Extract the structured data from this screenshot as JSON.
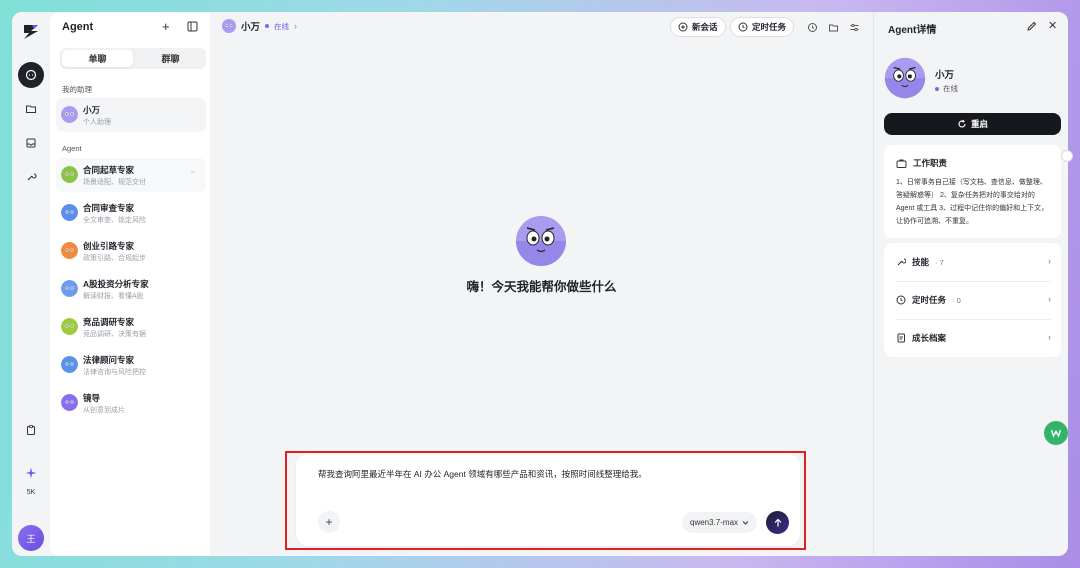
{
  "sidebar": {
    "title": "Agent",
    "tabs": [
      {
        "label": "单聊",
        "active": true
      },
      {
        "label": "群聊",
        "active": false
      }
    ],
    "assistant_section": "我的助理",
    "assistant": {
      "name": "小万",
      "desc": "个人助理"
    },
    "agent_section": "Agent",
    "agents": [
      {
        "name": "合同起草专家",
        "desc": "场景适配、规范交付"
      },
      {
        "name": "合同审查专家",
        "desc": "全文审查、锁定风险"
      },
      {
        "name": "创业引路专家",
        "desc": "政策引路、合规起步"
      },
      {
        "name": "A股投资分析专家",
        "desc": "解读财报、看懂A股"
      },
      {
        "name": "竞品调研专家",
        "desc": "竞品调研、决策有据"
      },
      {
        "name": "法律顾问专家",
        "desc": "法律咨询与风险把控"
      },
      {
        "name": "镜导",
        "desc": "从创意到成片"
      }
    ]
  },
  "rail": {
    "credit_label": "5K",
    "user_initial": "王"
  },
  "main": {
    "agent_name": "小万",
    "agent_status": "在线",
    "new_chat_label": "新会话",
    "scheduled_label": "定时任务",
    "greeting": "嗨！今天我能帮你做些什么",
    "composer": {
      "message": "帮我查询阿里最近半年在 AI 办公 Agent 领域有哪些产品和资讯，按照时间线整理给我。",
      "model": "qwen3.7-max"
    }
  },
  "details": {
    "title": "Agent详情",
    "name": "小万",
    "status": "在线",
    "restart_label": "重启",
    "duty_title": "工作职责",
    "duty_text": "1、日常事务自己接（写文档、查信息、做整理、答疑解惑等） 2、复杂任务把对的事交给对的 Agent 或工具 3、过程中记住你的偏好和上下文，让协作可追溯、不重复。",
    "skills_label": "技能",
    "skills_count": "· 7",
    "tasks_label": "定时任务",
    "tasks_count": "· 0",
    "growth_label": "成长档案"
  },
  "colors": {
    "accent": "#7a68ee",
    "dark": "#16181d",
    "highlight": "#e02020"
  }
}
